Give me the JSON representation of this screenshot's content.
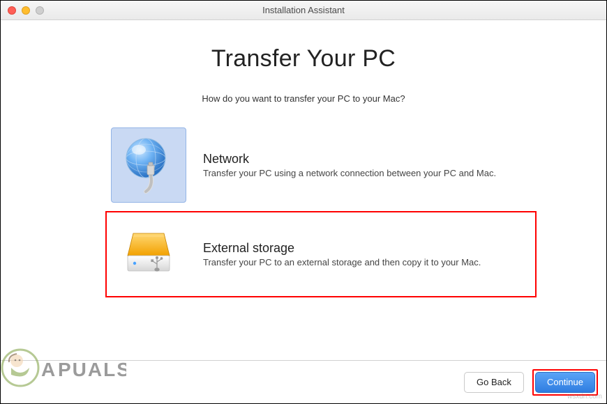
{
  "window": {
    "title": "Installation Assistant"
  },
  "page": {
    "heading": "Transfer Your PC",
    "subtitle": "How do you want to transfer your PC to your Mac?"
  },
  "options": {
    "network": {
      "title": "Network",
      "desc": "Transfer your PC using a network connection between your PC and Mac.",
      "selected": true
    },
    "external": {
      "title": "External storage",
      "desc": "Transfer your PC to an external storage and then copy it to your Mac.",
      "selected": false
    }
  },
  "buttons": {
    "back": "Go Back",
    "continue": "Continue"
  },
  "watermark": {
    "site_right": "wsxdn.com",
    "site_left": "A PUALS"
  },
  "annotations": {
    "external_highlighted": true,
    "continue_highlighted": true
  }
}
